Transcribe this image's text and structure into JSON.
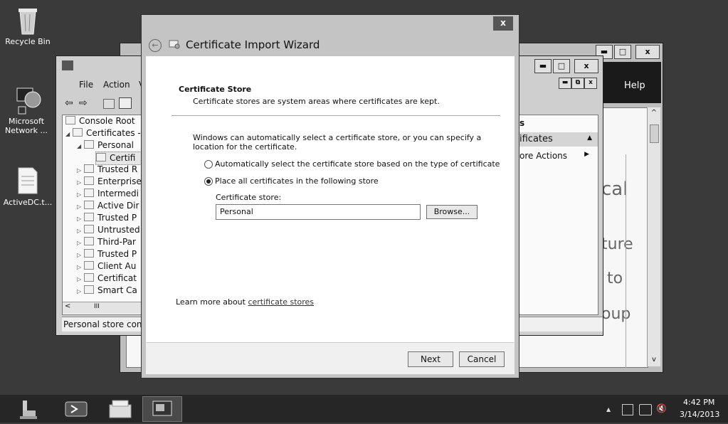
{
  "desktop": {
    "icons": [
      {
        "label": "Recycle Bin",
        "icon": "recycle-bin-icon"
      },
      {
        "label": "Microsoft Network ...",
        "icon": "network-icon"
      },
      {
        "label": "ActiveDC.t...",
        "icon": "document-icon"
      }
    ]
  },
  "mmc": {
    "menu": [
      "File",
      "Action",
      "V"
    ],
    "tree": [
      {
        "label": "Console Root"
      },
      {
        "label": "Certificates -"
      },
      {
        "label": "Personal"
      },
      {
        "label": "Certifi"
      },
      {
        "label": "Trusted R"
      },
      {
        "label": "Enterprise"
      },
      {
        "label": "Intermedi"
      },
      {
        "label": "Active Dir"
      },
      {
        "label": "Trusted P"
      },
      {
        "label": "Untrusted"
      },
      {
        "label": "Third-Par"
      },
      {
        "label": "Trusted P"
      },
      {
        "label": "Client Au"
      },
      {
        "label": "Certificat"
      },
      {
        "label": "Smart Ca"
      }
    ],
    "status": "Personal store contai",
    "actions": {
      "header": "s",
      "section": "ificates",
      "more": "ore Actions"
    }
  },
  "bg_window": {
    "help": "Help",
    "texts": [
      "cal",
      "ture",
      "to",
      "oup"
    ]
  },
  "wizard": {
    "title": "Certificate Import Wizard",
    "close": "x",
    "heading": "Certificate Store",
    "subheading": "Certificate stores are system areas where certificates are kept.",
    "intro": "Windows can automatically select a certificate store, or you can specify a location for the certificate.",
    "option_auto": "Automatically select the certificate store based on the type of certificate",
    "option_manual": "Place all certificates in the following store",
    "selected_option": "manual",
    "store_label": "Certificate store:",
    "store_value": "Personal",
    "browse": "Browse...",
    "learn_prefix": "Learn more about ",
    "learn_link": "certificate stores",
    "next": "Next",
    "cancel": "Cancel"
  },
  "taskbar": {
    "time": "4:42 PM",
    "date": "3/14/2013",
    "tray_arrow": "▲"
  }
}
